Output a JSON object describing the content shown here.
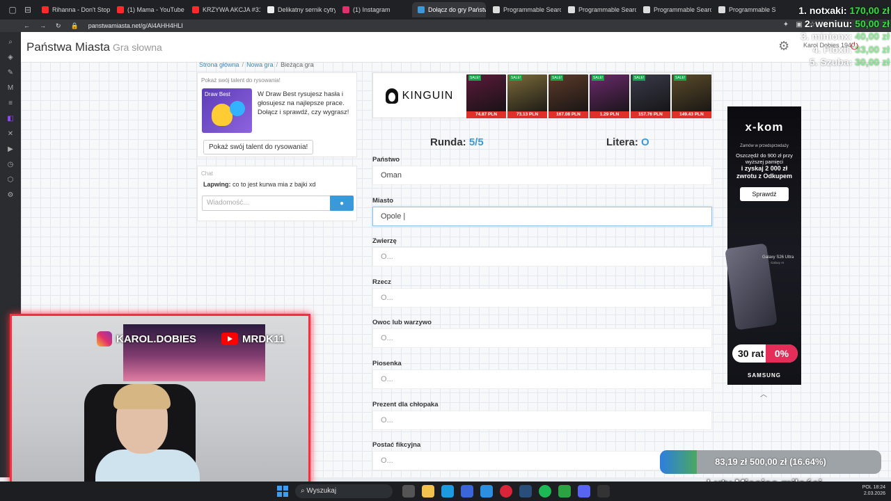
{
  "browser": {
    "tabs": [
      {
        "label": "Rihanna - Don't Stop",
        "color": "#ff2b2b"
      },
      {
        "label": "(1) Mama - YouTube",
        "color": "#ff2b2b"
      },
      {
        "label": "KRZYWA AKCJA #31",
        "color": "#ff2b2b"
      },
      {
        "label": "Delikatny sernik cytry",
        "color": "#eeeeee"
      },
      {
        "label": "(1) Instagram",
        "color": "#e1306c"
      },
      {
        "label": "Dołącz do gry Państwa M",
        "color": "#3a9ad9"
      },
      {
        "label": "Programmable Searc",
        "color": "#dddddd"
      },
      {
        "label": "Programmable Searc",
        "color": "#dddddd"
      },
      {
        "label": "Programmable Searc",
        "color": "#dddddd"
      },
      {
        "label": "Programmable S",
        "color": "#dddddd"
      }
    ],
    "url": "panstwamiasta.net/g/Al4AHH4HLI"
  },
  "site": {
    "brand": "Państwa Miasta",
    "brand_sub": "Gra słowna",
    "user": "Karol Dobies 1940"
  },
  "breadcrumb": {
    "home": "Strona główna",
    "new_game": "Nowa gra",
    "current": "Bieżąca gra"
  },
  "promo": {
    "header": "Pokaż swój talent do rysowania!",
    "image_label": "Draw Best",
    "text": "W Draw Best rysujesz hasła i głosujesz na najlepsze prace. Dołącz i sprawdź, czy wygrasz!",
    "button": "Pokaż swój talent do rysowania!"
  },
  "chat": {
    "header": "Chat",
    "messages": [
      {
        "author": "Lapwing:",
        "text": "co to jest kurwa mia z bajki xd"
      }
    ],
    "placeholder": "Wiadomość..."
  },
  "banner": {
    "brand": "KINGUIN",
    "games": [
      {
        "badge": "SALE!",
        "price": "74.87 PLN",
        "color": "#5a1a3a"
      },
      {
        "badge": "SALE!",
        "price": "73.13 PLN",
        "color": "#7a6a3a"
      },
      {
        "badge": "SALE!",
        "price": "167.08 PLN",
        "color": "#5c3a2a"
      },
      {
        "badge": "SALE!",
        "price": "1.29 PLN",
        "color": "#6a2a6a"
      },
      {
        "badge": "SALE!",
        "price": "157.76 PLN",
        "color": "#3a3a4a"
      },
      {
        "badge": "SALE!",
        "price": "149.43 PLN",
        "color": "#5a4a2a"
      }
    ]
  },
  "game": {
    "round_label": "Runda:",
    "round_value": "5/5",
    "letter_label": "Litera:",
    "letter_value": "O",
    "fields": [
      {
        "label": "Państwo",
        "value": "Oman",
        "placeholder": "",
        "focused": false
      },
      {
        "label": "Miasto",
        "value": "Opole |",
        "placeholder": "",
        "focused": true
      },
      {
        "label": "Zwierzę",
        "value": "",
        "placeholder": "O...",
        "focused": false
      },
      {
        "label": "Rzecz",
        "value": "",
        "placeholder": "O...",
        "focused": false
      },
      {
        "label": "Owoc lub warzywo",
        "value": "",
        "placeholder": "O...",
        "focused": false
      },
      {
        "label": "Piosenka",
        "value": "",
        "placeholder": "O...",
        "focused": false
      },
      {
        "label": "Prezent dla chłopaka",
        "value": "",
        "placeholder": "O...",
        "focused": false
      },
      {
        "label": "Postać fikcyjna",
        "value": "",
        "placeholder": "O...",
        "focused": false
      }
    ]
  },
  "ad": {
    "logo": "x-kom",
    "preorder": "Zamów w przedsprzedaży",
    "line1": "Oszczędź do 900 zł przy wyższej pamięci",
    "line2": "i zyskaj 2 000 zł zwrotu z Odkupem",
    "button": "Sprawdź",
    "model": "Galaxy S26 Ultra",
    "model_sub": "Galaxy AI",
    "rat": "30 rat",
    "pct": "0%",
    "footer": "SAMSUNG"
  },
  "webcam": {
    "instagram": "KAROL.DOBIES",
    "youtube": "MRDK11"
  },
  "leaderboard": [
    {
      "name": "1. notxaki:",
      "value": "170,00 zł"
    },
    {
      "name": "2. weniuu:",
      "value": "50,00 zł"
    },
    {
      "name": "3. minionx:",
      "value": "40,00 zł"
    },
    {
      "name": "4. Floxii:",
      "value": "33,00 zł"
    },
    {
      "name": "5. Szuba:",
      "value": "30,00 zł"
    }
  ],
  "goal": {
    "text": "83,19 zł  500,00 zł (16.64%)",
    "fraction": 0.1664,
    "title": "Luty Miesiąc miłości"
  },
  "taskbar": {
    "search": "Wyszukaj",
    "lang": "POL",
    "time": "18:24",
    "date": "2.03.2026"
  }
}
